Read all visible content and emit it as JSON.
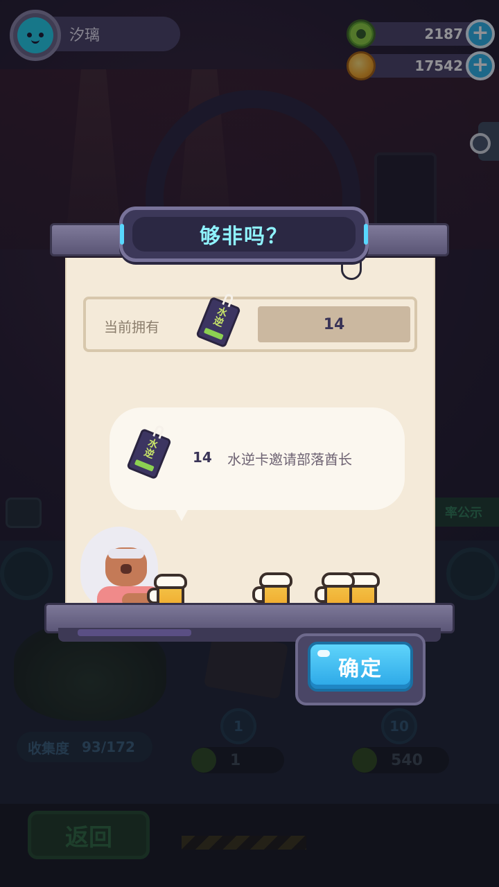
{
  "player": {
    "name": "汐璃"
  },
  "currencies": [
    {
      "icon": "green-ring-coin",
      "value": "2187"
    },
    {
      "icon": "gold-planet-coin",
      "value": "17542"
    }
  ],
  "dialog": {
    "title": "够非吗？",
    "owned_label": "当前拥有",
    "owned_value": "14",
    "card_glyph": "水逆",
    "bubble_count": "14",
    "bubble_text": "水逆卡邀请部落酋长",
    "confirm_label": "确定"
  },
  "background": {
    "collection_label": "收集度",
    "collection_value": "93/172",
    "counter_left": "1",
    "counter_right": "540",
    "circle_left": "1",
    "circle_right": "10",
    "back_label": "返回",
    "green_tag": "率公示"
  },
  "colors": {
    "accent_cyan": "#8ff3ff",
    "confirm_blue": "#2aa6e6",
    "paper": "#f4ead9"
  }
}
